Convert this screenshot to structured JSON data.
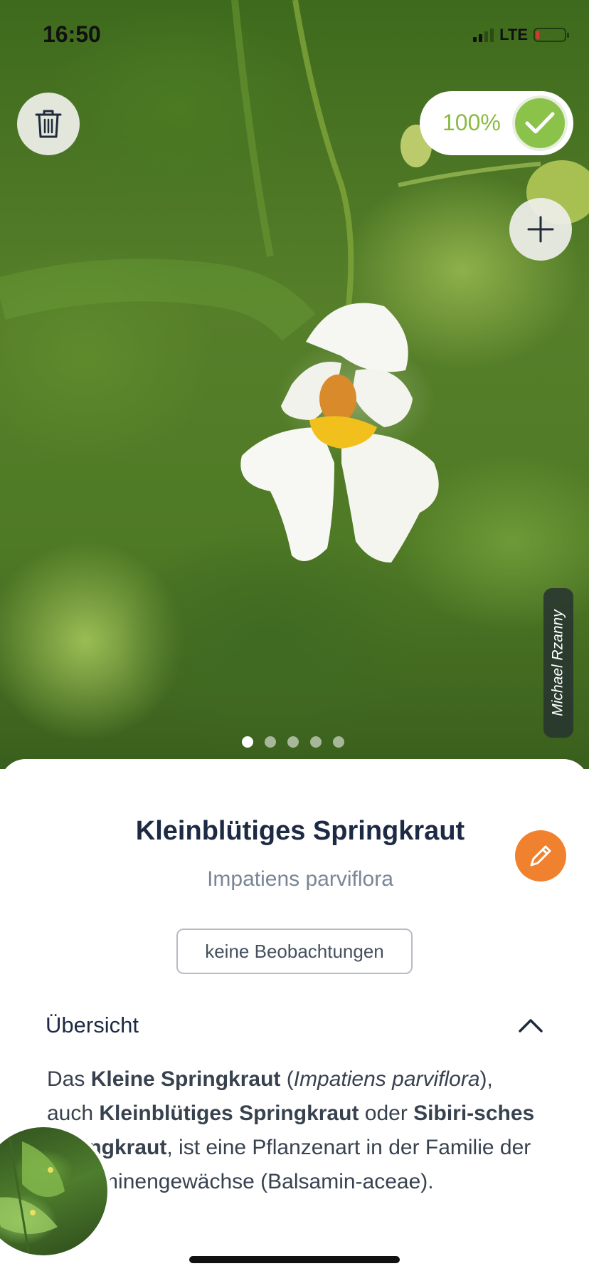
{
  "status_bar": {
    "time": "16:50",
    "network": "LTE"
  },
  "photo": {
    "credit": "Michael Rzanny",
    "page_count": 5,
    "active_page": 1
  },
  "confidence": {
    "label": "100%",
    "color": "#8bc34a"
  },
  "icons": {
    "trash": "trash-icon",
    "add": "plus-icon",
    "check": "check-icon",
    "edit": "pencil-icon",
    "collapse": "chevron-up-icon"
  },
  "species": {
    "common_name": "Kleinblütiges Springkraut",
    "scientific_name": "Impatiens parviflora",
    "observations": "keine Beobachtungen"
  },
  "overview": {
    "header": "Übersicht",
    "parts": [
      {
        "text": "Das ",
        "style": "normal"
      },
      {
        "text": "Kleine Springkraut",
        "style": "bold"
      },
      {
        "text": " (",
        "style": "normal"
      },
      {
        "text": "Impatiens parviflora",
        "style": "italic"
      },
      {
        "text": "), auch ",
        "style": "normal"
      },
      {
        "text": "Kleinblütiges Springkraut",
        "style": "bold"
      },
      {
        "text": " oder ",
        "style": "normal"
      },
      {
        "text": "Sibiri-sches Springkraut",
        "style": "bold"
      },
      {
        "text": ", ist eine Pflanzenart in der Familie der Balsaminengewächse (Balsamin-aceae).",
        "style": "normal"
      }
    ]
  },
  "colors": {
    "accent_orange": "#f0812e",
    "title_navy": "#1d2a44"
  }
}
